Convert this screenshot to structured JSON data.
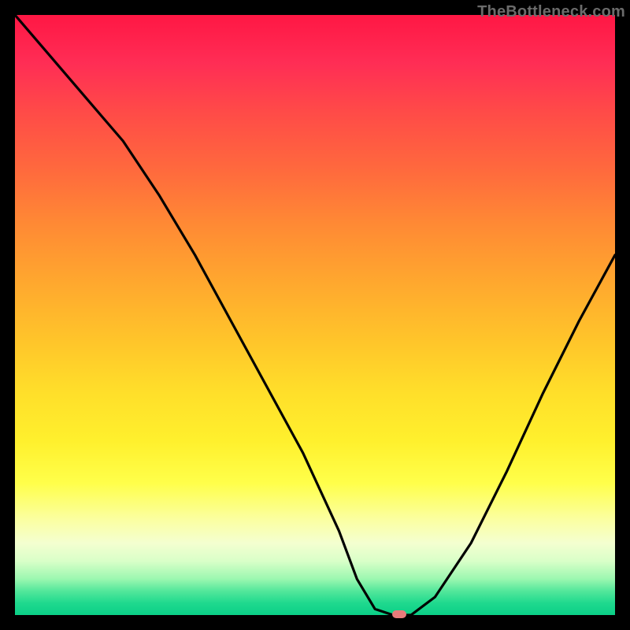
{
  "watermark": "TheBottleneck.com",
  "colors": {
    "frame_bg": "#000000",
    "curve_stroke": "#000000",
    "marker_fill": "#e87b7b",
    "gradient_top": "#ff1744",
    "gradient_mid": "#ffdf2a",
    "gradient_bottom": "#0bcf87"
  },
  "chart_data": {
    "type": "line",
    "title": "",
    "xlabel": "",
    "ylabel": "",
    "xlim": [
      0,
      100
    ],
    "ylim": [
      0,
      100
    ],
    "series": [
      {
        "name": "bottleneck-curve",
        "x": [
          0,
          6,
          12,
          18,
          24,
          30,
          36,
          42,
          48,
          54,
          57,
          60,
          63,
          66,
          70,
          76,
          82,
          88,
          94,
          100
        ],
        "values": [
          100,
          93,
          86,
          79,
          70,
          60,
          49,
          38,
          27,
          14,
          6,
          1,
          0,
          0,
          3,
          12,
          24,
          37,
          49,
          60
        ]
      }
    ],
    "optimum_marker": {
      "x": 64,
      "y": 0
    },
    "grid": false,
    "legend": false
  }
}
